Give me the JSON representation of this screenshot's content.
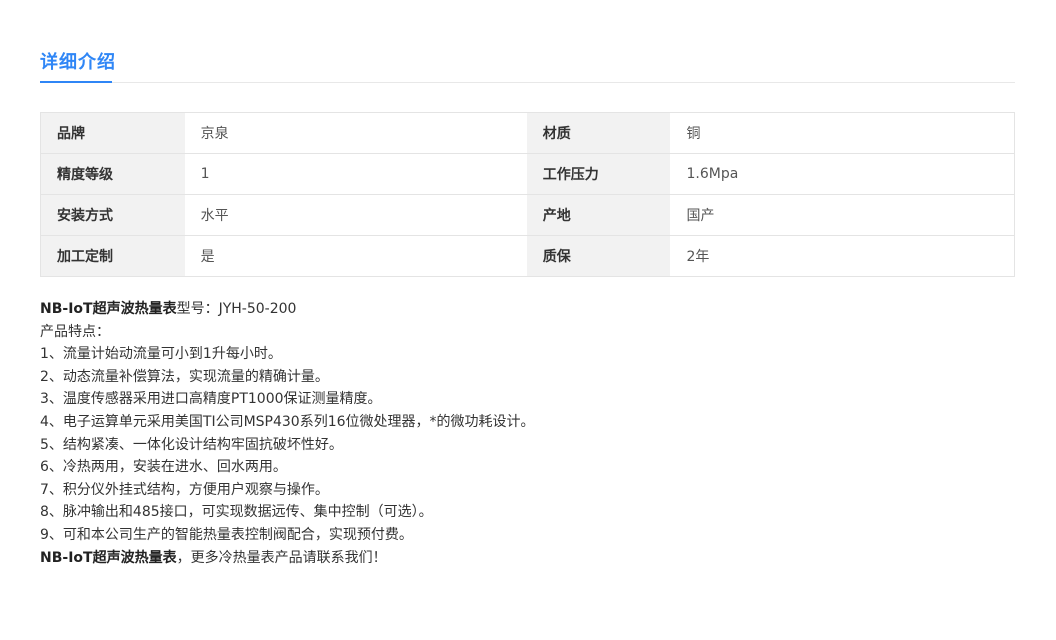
{
  "section": {
    "title": "详细介绍"
  },
  "specs": {
    "rows": [
      [
        {
          "key": "品牌",
          "value": "京泉"
        },
        {
          "key": "材质",
          "value": "铜"
        }
      ],
      [
        {
          "key": "精度等级",
          "value": "1"
        },
        {
          "key": "工作压力",
          "value": "1.6Mpa"
        }
      ],
      [
        {
          "key": "安装方式",
          "value": "水平"
        },
        {
          "key": "产地",
          "value": "国产"
        }
      ],
      [
        {
          "key": "加工定制",
          "value": "是"
        },
        {
          "key": "质保",
          "value": "2年"
        }
      ]
    ]
  },
  "description": {
    "model_product": "NB-IoT超声波热量表",
    "model_text": "型号：JYH-50-200",
    "features_heading": "产品特点：",
    "features": [
      "1、流量计始动流量可小到1升每小时。",
      "2、动态流量补偿算法，实现流量的精确计量。",
      "3、温度传感器采用进口高精度PT1000保证测量精度。",
      "4、电子运算单元采用美国TI公司MSP430系列16位微处理器，*的微功耗设计。",
      "5、结构紧凑、一体化设计结构牢固抗破坏性好。",
      "6、冷热两用，安装在进水、回水两用。",
      "7、积分仪外挂式结构，方便用户观察与操作。",
      "8、脉冲输出和485接口，可实现数据远传、集中控制（可选）。",
      "9、可和本公司生产的智能热量表控制阀配合，实现预付费。"
    ],
    "closing_product": "NB-IoT超声波热量表",
    "closing_text": "，更多冷热量表产品请联系我们！"
  }
}
